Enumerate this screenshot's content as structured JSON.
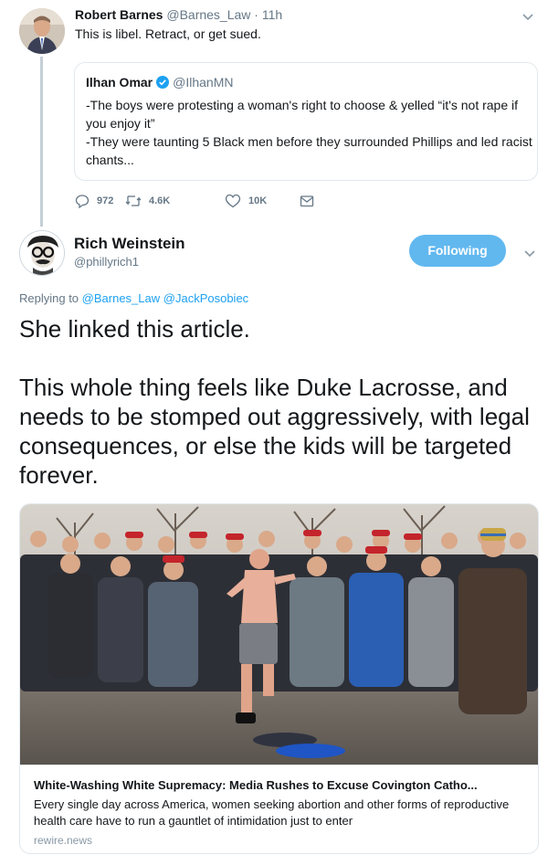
{
  "thread": {
    "tweet1": {
      "name": "Robert Barnes",
      "handle": "@Barnes_Law",
      "separator": "·",
      "time": "11h",
      "text": "This is libel. Retract, or get sued.",
      "quoted": {
        "name": "Ilhan Omar",
        "verified": true,
        "handle": "@IlhanMN",
        "line1": "-The boys were protesting a woman's right to choose & yelled “it's not rape if you enjoy it”",
        "line2": "-They were taunting 5 Black men before they surrounded Phillips and led racist chants..."
      },
      "actions": {
        "replies": "972",
        "retweets": "4.6K",
        "likes": "10K"
      }
    }
  },
  "main_tweet": {
    "name": "Rich Weinstein",
    "handle": "@phillyrich1",
    "follow_label": "Following",
    "replying_label": "Replying to",
    "replying_handle1": "@Barnes_Law",
    "replying_handle2": "@JackPosobiec",
    "paragraph1": "She linked this article.",
    "paragraph2": "This whole thing feels like Duke Lacrosse, and needs to be stomped out aggressively, with legal consequences, or else the kids will be targeted forever."
  },
  "link_card": {
    "title": "White-Washing White Supremacy: Media Rushes to Excuse Covington Catho...",
    "description": "Every single day across America, women seeking abortion and other forms of reproductive health care have to run a gauntlet of intimidation just to enter",
    "domain": "rewire.news"
  },
  "colors": {
    "link": "#1da1f2",
    "follow_button": "#61b8ef",
    "muted": "#657786",
    "border": "#e1e8ed"
  },
  "icons": [
    "chevron-down-icon",
    "verified-badge-icon",
    "reply-icon",
    "retweet-icon",
    "like-icon",
    "direct-message-icon"
  ]
}
